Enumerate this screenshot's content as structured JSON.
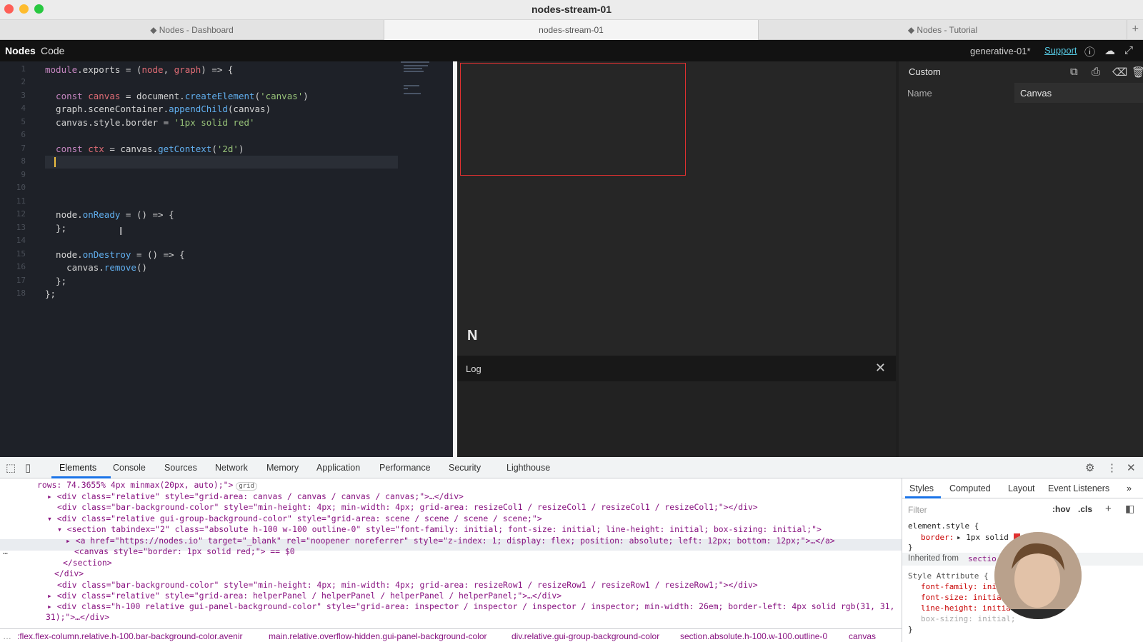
{
  "window": {
    "title": "nodes-stream-01"
  },
  "browser_tabs": [
    {
      "label": "◆ Nodes - Dashboard"
    },
    {
      "label": "nodes-stream-01"
    },
    {
      "label": "◆ Nodes - Tutorial"
    }
  ],
  "appbar": {
    "nodes": "Nodes",
    "code": "Code",
    "project": "generative-01*",
    "support": "Support"
  },
  "editor": {
    "line_numbers": [
      "1",
      "2",
      "3",
      "4",
      "5",
      "6",
      "7",
      "8",
      "9",
      "10",
      "11",
      "12",
      "13",
      "14",
      "15",
      "16",
      "17",
      "18"
    ]
  },
  "scene": {
    "logo": "N"
  },
  "log": {
    "title": "Log",
    "close": "✕"
  },
  "inspector": {
    "title": "Custom",
    "name_label": "Name",
    "name_value": "Canvas"
  },
  "devtools": {
    "tabs": [
      "Elements",
      "Console",
      "Sources",
      "Network",
      "Memory",
      "Application",
      "Performance",
      "Security",
      "Lighthouse"
    ],
    "breadcrumbs": [
      ":flex.flex-column.relative.h-100.bar-background-color.avenir",
      "main.relative.overflow-hidden.gui-panel-background-color",
      "div.relative.gui-group-background-color",
      "section.absolute.h-100.w-100.outline-0",
      "canvas"
    ],
    "styles_tabs": [
      "Styles",
      "Computed",
      "Layout",
      "Event Listeners"
    ],
    "filter_placeholder": "Filter",
    "hov": ":hov",
    "cls": ".cls",
    "element_style": "element.style {",
    "border_prop": "border:",
    "border_val": "▸ 1px solid",
    "inherited": "Inherited from",
    "inherited_from": "sectio",
    "style_attr": "Style Attribute {",
    "props": [
      "font-family: ini",
      "font-size: initia",
      "line-height: initia",
      "box-sizing: initial;"
    ]
  }
}
